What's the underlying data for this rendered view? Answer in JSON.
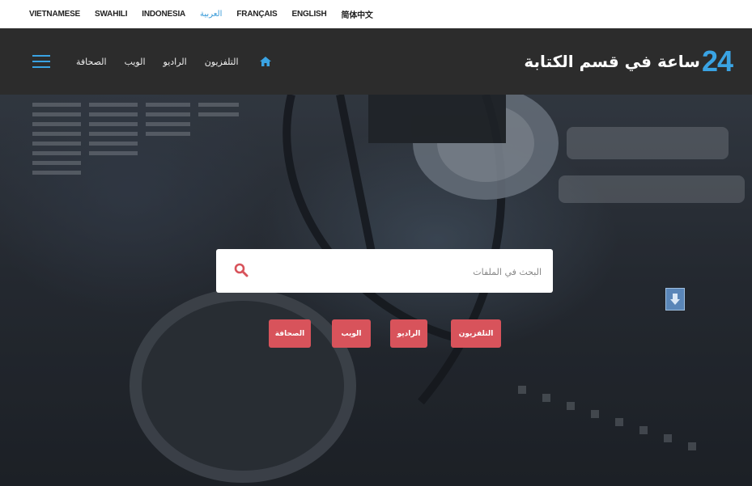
{
  "languages": [
    "VIETNAMESE",
    "SWAHILI",
    "INDONESIA",
    "العربية",
    "FRANÇAIS",
    "ENGLISH",
    "简体中文"
  ],
  "header": {
    "brand_number": "24",
    "brand_title": "ساعة في قسم الكتابة",
    "nav": {
      "tv": "التلفزيون",
      "radio": "الراديو",
      "web": "الويب",
      "press": "الصحافة"
    }
  },
  "search": {
    "placeholder": "البحث في الملفات"
  },
  "chips": {
    "tv": "التلفزيون",
    "radio": "الراديو",
    "web": "الويب",
    "press": "الصحافة"
  },
  "colors": {
    "accent_blue": "#3aa3e3",
    "chip_red": "#d8535b",
    "header_bg": "#2c2c2c"
  }
}
